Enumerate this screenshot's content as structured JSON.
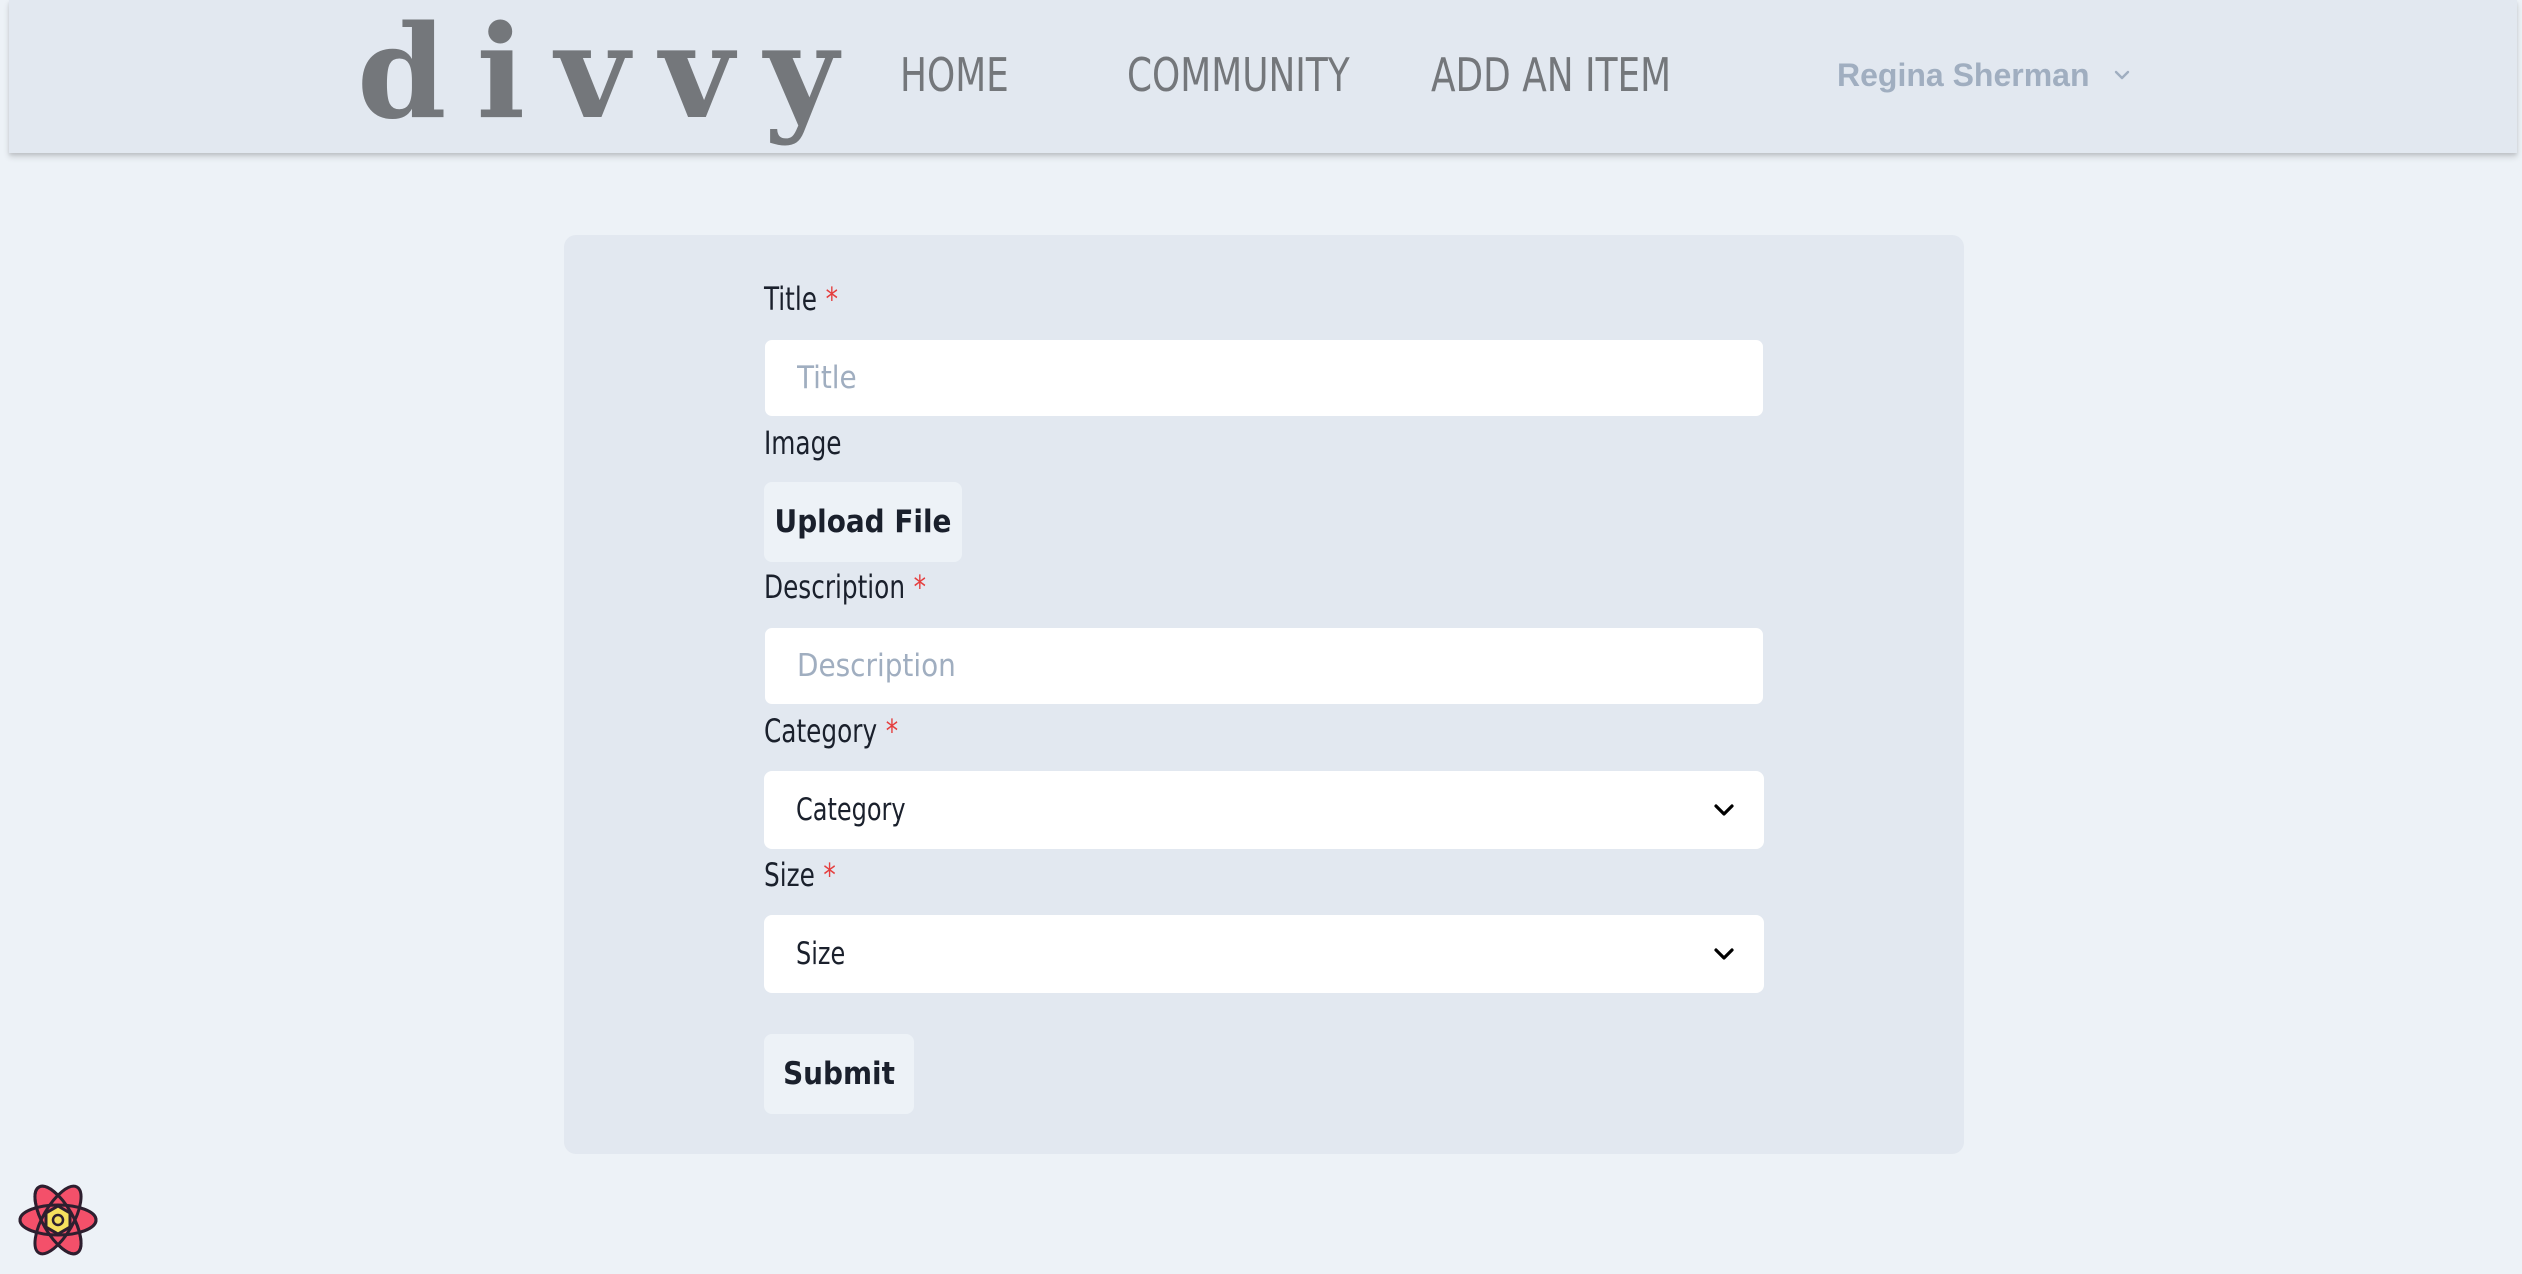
{
  "header": {
    "logo": "divvy",
    "nav": {
      "home": "HOME",
      "community": "COMMUNITY",
      "add_item": "ADD AN ITEM"
    },
    "user": {
      "name": "Regina Sherman",
      "icon": "chevron-down-icon"
    }
  },
  "form": {
    "title": {
      "label": "Title",
      "required_mark": "*",
      "placeholder": "Title",
      "value": ""
    },
    "image": {
      "label": "Image",
      "button": "Upload File"
    },
    "description": {
      "label": "Description",
      "required_mark": "*",
      "placeholder": "Description",
      "value": ""
    },
    "category": {
      "label": "Category",
      "required_mark": "*",
      "selected": "Category",
      "icon": "chevron-down-icon"
    },
    "size": {
      "label": "Size",
      "required_mark": "*",
      "selected": "Size",
      "icon": "chevron-down-icon"
    },
    "submit": "Submit"
  },
  "devtools": {
    "icon": "react-devtools-icon"
  },
  "colors": {
    "page_bg": "#edf2f7",
    "nav_bg": "#e2e8f0",
    "card_bg": "#e2e8f0",
    "logo_gray": "#74777b",
    "required_red": "#e53e3e",
    "placeholder_gray": "#a0aec0",
    "user_gray": "#a0aec0"
  }
}
